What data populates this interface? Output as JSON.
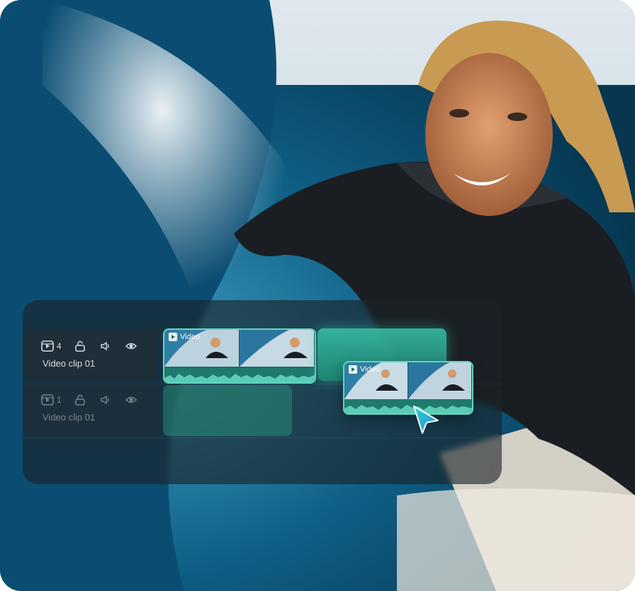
{
  "tracks": [
    {
      "count": "4",
      "label": "Video clip 01"
    },
    {
      "count": "1",
      "label": "Video clip 01"
    }
  ],
  "clips": {
    "main_title": "Video",
    "dragging_title": "Video"
  },
  "icons": {
    "track": "video-track-icon",
    "lock": "unlock-icon",
    "audio": "speaker-icon",
    "visibility": "eye-icon",
    "cursor": "pointer-cursor-icon"
  },
  "colors": {
    "accent": "#5fd6c2",
    "clip_fill": "#1d6e63",
    "cursor": "#2bb3e0"
  }
}
